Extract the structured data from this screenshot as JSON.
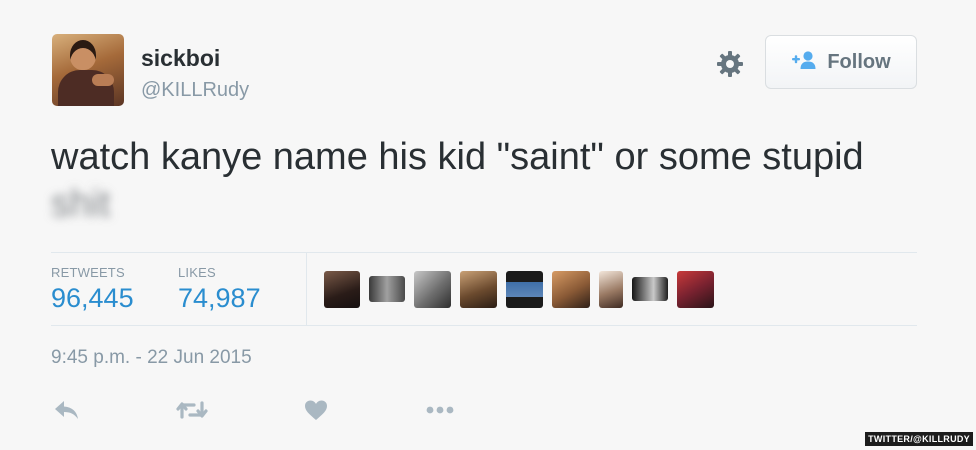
{
  "user": {
    "name": "sickboi",
    "handle": "@KILLRudy"
  },
  "header": {
    "follow_label": "Follow"
  },
  "tweet": {
    "text": "watch kanye name his kid \"saint\" or some stupid",
    "censored_word": "shit"
  },
  "stats": {
    "retweets_label": "RETWEETS",
    "retweets_value": "96,445",
    "likes_label": "LIKES",
    "likes_value": "74,987"
  },
  "timestamp": "9:45 p.m. - 22 Jun 2015",
  "watermark": "TWITTER/@KILLRUDY",
  "icons": {
    "settings": "gear-icon",
    "follow": "add-person-icon",
    "reply": "reply-icon",
    "retweet": "retweet-icon",
    "like": "heart-icon",
    "more": "more-icon"
  },
  "colors": {
    "link_blue": "#2a8dcf",
    "follow_icon_blue": "#55acee",
    "muted_gray": "#8899a6",
    "text_dark": "#292f33",
    "action_icon": "#aab8c2"
  },
  "liked_by_avatar_count": 9
}
